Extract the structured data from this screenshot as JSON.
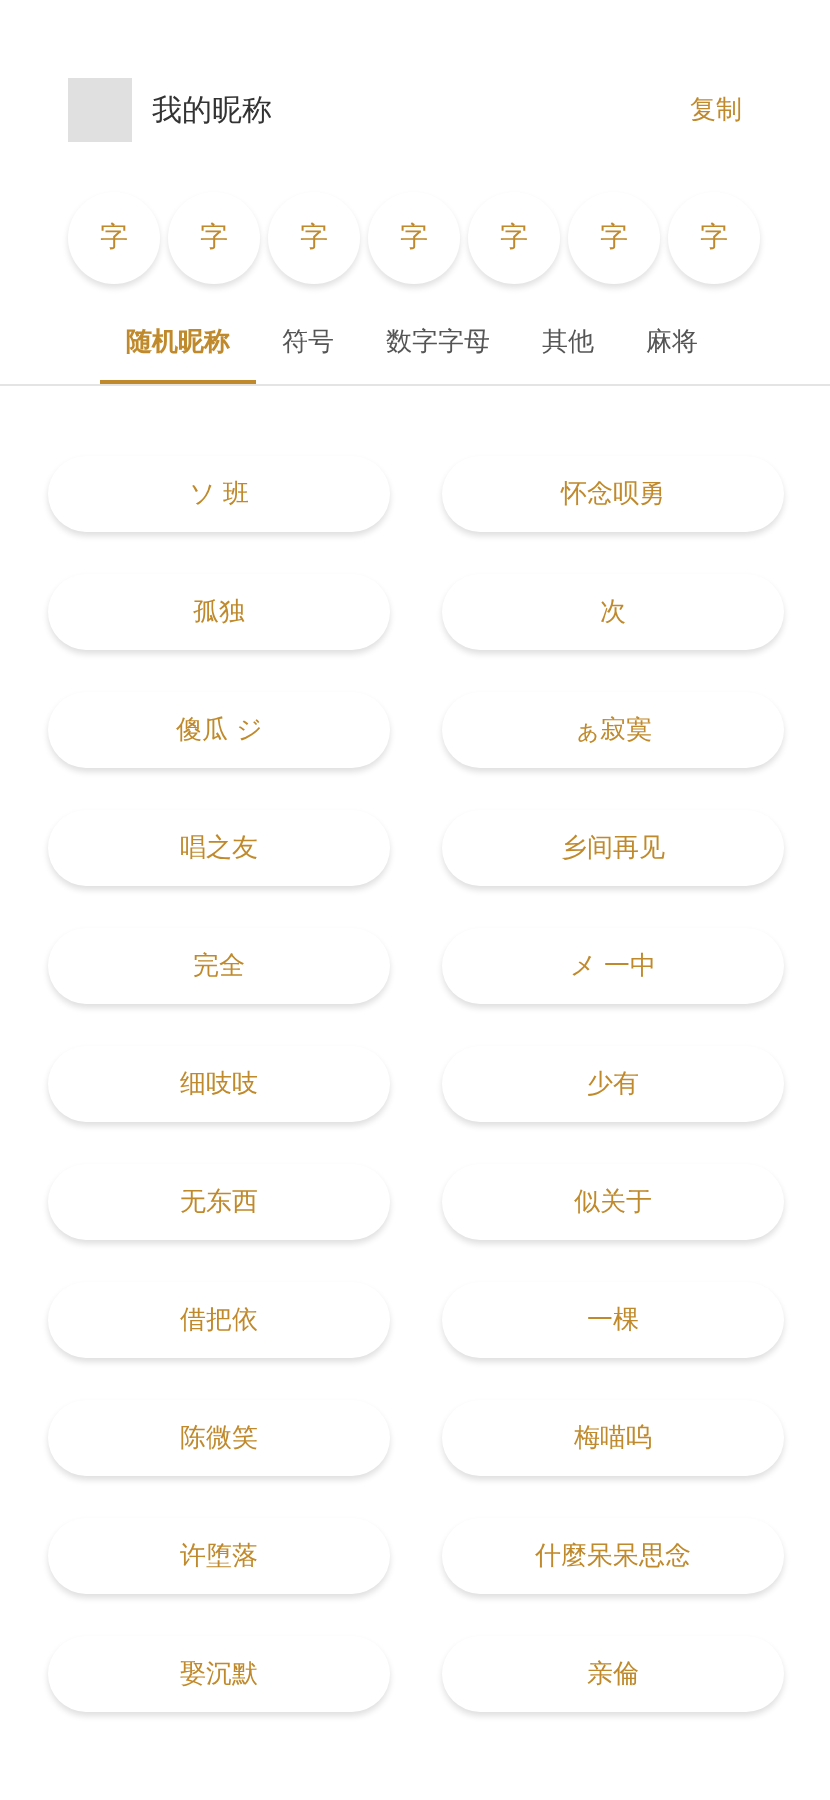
{
  "header": {
    "nickname": "我的昵称",
    "copy_button": "复制"
  },
  "styles": [
    "字",
    "字",
    "字",
    "字",
    "字",
    "字",
    "字"
  ],
  "tabs": [
    {
      "label": "随机昵称",
      "selected": true
    },
    {
      "label": "符号",
      "selected": false
    },
    {
      "label": "数字字母",
      "selected": false
    },
    {
      "label": "其他",
      "selected": false
    },
    {
      "label": "麻将",
      "selected": false
    }
  ],
  "names": [
    "ソ 班",
    "怀念呗勇",
    "孤独",
    "次",
    "傻瓜 ジ",
    "ぁ寂寞",
    "唱之友",
    "乡间再见",
    "完全",
    "メ 一中",
    "细吱吱",
    "少有",
    "无东西",
    "似关于",
    "借把依",
    "一棵",
    "陈微笑",
    "梅喵呜",
    "许堕落",
    "什麼呆呆思念",
    "娶沉默",
    "亲倫"
  ]
}
